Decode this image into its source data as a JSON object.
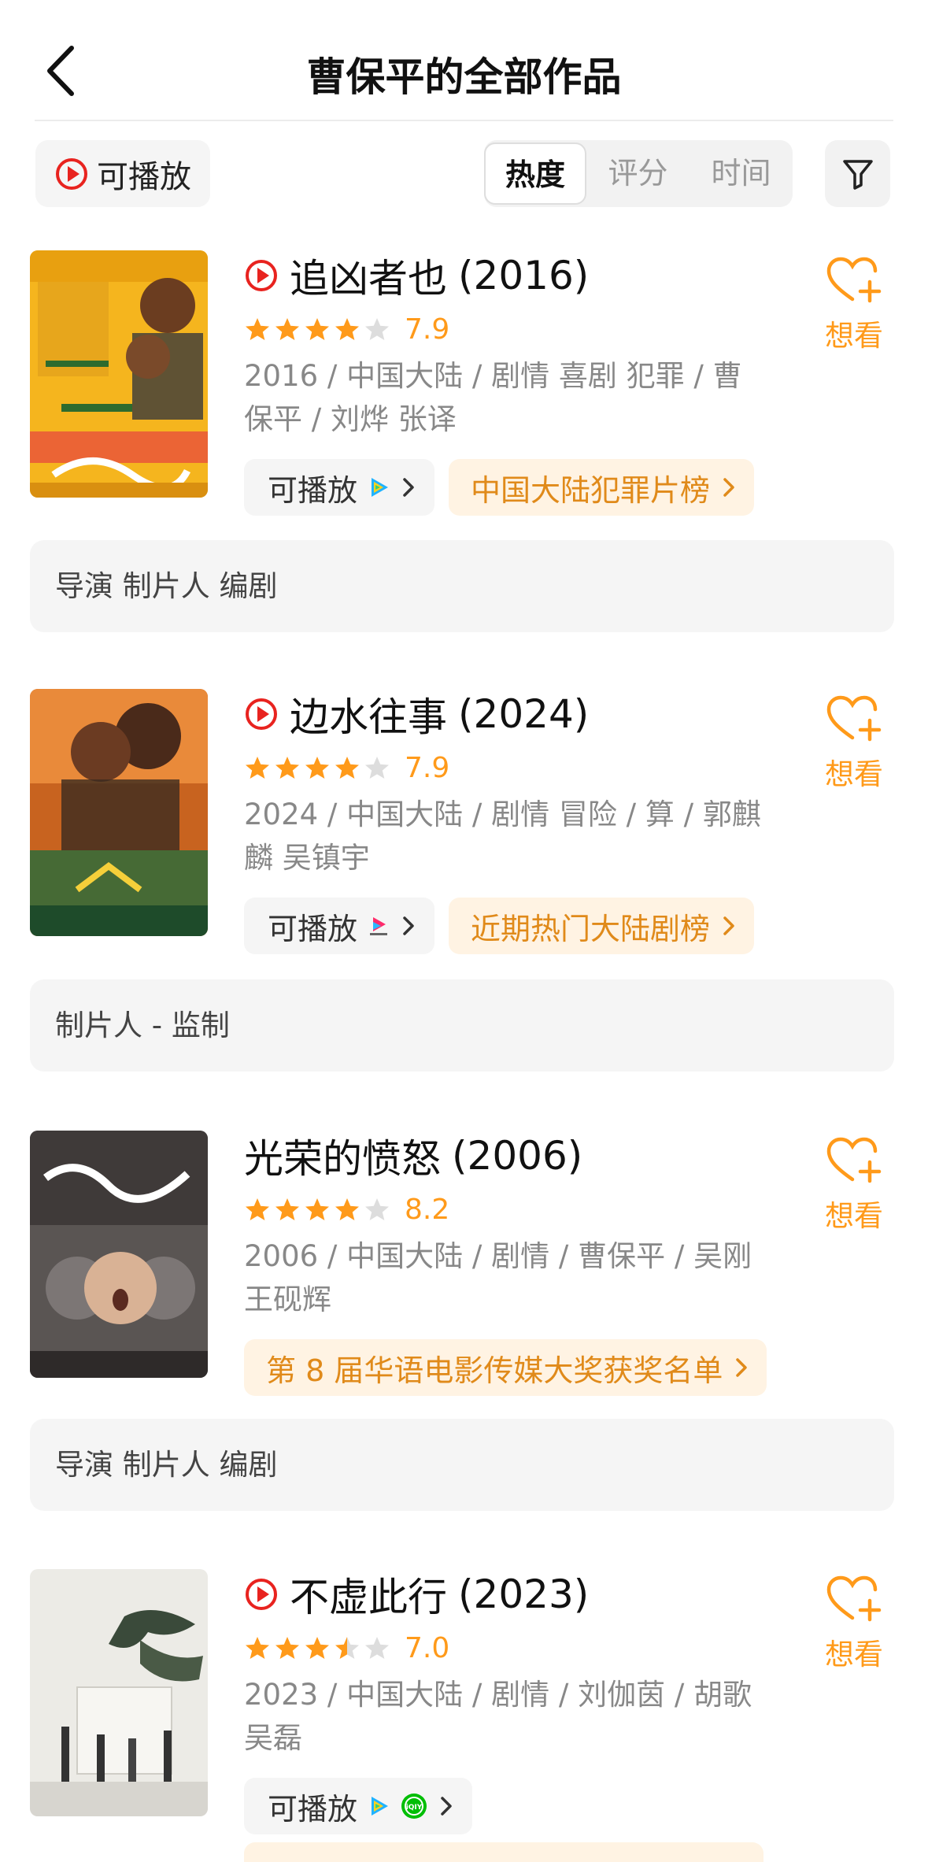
{
  "header": {
    "title": "曹保平的全部作品"
  },
  "filters": {
    "playable_label": "可播放",
    "sort_tabs": [
      "热度",
      "评分",
      "时间"
    ],
    "active_sort": "热度"
  },
  "colors": {
    "accent": "#ff9a1a",
    "play_red": "#e8231f",
    "rank_bg": "#fff3e3",
    "rank_text": "#e08a1a"
  },
  "movies": [
    {
      "title": "追凶者也",
      "year": "(2016)",
      "playable": true,
      "stars": 4,
      "rating": "7.9",
      "meta": "2016 / 中国大陆 / 剧情 喜剧 犯罪 / 曹保平 / 刘烨 张译",
      "play_chip": "可播放",
      "platforms": [
        "tencent-video-icon"
      ],
      "rank_chip": "中国大陆犯罪片榜",
      "want_label": "想看",
      "roles": "导演 制片人 编剧"
    },
    {
      "title": "边水往事",
      "year": "(2024)",
      "playable": true,
      "stars": 4,
      "rating": "7.9",
      "meta": "2024 / 中国大陆 / 剧情 冒险 / 算 / 郭麒麟 吴镇宇",
      "play_chip": "可播放",
      "platforms": [
        "youku-icon"
      ],
      "rank_chip": "近期热门大陆剧榜",
      "want_label": "想看",
      "roles": "制片人 - 监制"
    },
    {
      "title": "光荣的愤怒",
      "year": "(2006)",
      "playable": false,
      "stars": 4,
      "rating": "8.2",
      "meta": "2006 / 中国大陆 / 剧情 / 曹保平 / 吴刚 王砚辉",
      "rank_chip": "第 8 届华语电影传媒大奖获奖名单",
      "want_label": "想看",
      "roles": "导演 制片人 编剧"
    },
    {
      "title": "不虚此行",
      "year": "(2023)",
      "playable": true,
      "stars": 3.5,
      "rating": "7.0",
      "meta": "2023 / 中国大陆 / 剧情 / 刘伽茵 / 胡歌 吴磊",
      "play_chip": "可播放",
      "platforms": [
        "tencent-video-icon",
        "iqiyi-icon"
      ],
      "want_label": "想看"
    }
  ]
}
